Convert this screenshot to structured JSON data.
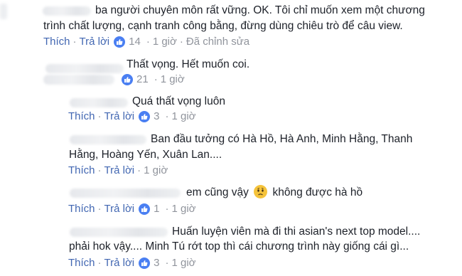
{
  "actions": {
    "like": "Thích",
    "reply": "Trả lời",
    "separator": "·"
  },
  "comments": [
    {
      "lines": [
        "ba người chuyên môn rất vững. OK. Tôi chỉ muốn xem một chương",
        "trình chất lượng, cạnh tranh công bằng, đừng dùng chiêu trò để câu view."
      ],
      "likes": "14",
      "time": "1 giờ",
      "edited": "Đã chỉnh sửa"
    },
    {
      "lines": [
        "Thất vọng. Hết muốn coi."
      ],
      "likes": "21",
      "time": "1 giờ"
    },
    {
      "lines": [
        "Quá thất vọng luôn"
      ],
      "likes": "3",
      "time": "1 giờ"
    },
    {
      "lines": [
        "Ban đầu tưởng có Hà Hồ, Hà Anh, Minh Hằng, Thanh",
        "Hằng, Hoàng Yến, Xuân Lan...."
      ],
      "time": "1 giờ"
    },
    {
      "text_before": "em cũng vậy",
      "emoji": "confused-face",
      "text_after": "không được hà hồ",
      "likes": "1",
      "time": "1 giờ"
    },
    {
      "lines": [
        "Huấn luyện viên mà đi thi asian's next top model....",
        "phải hok vậy.... Minh Tú rớt top thì cái chương trình này giống cái gì..."
      ],
      "likes": "3",
      "time": "1 giờ"
    }
  ],
  "colors": {
    "link": "#4267b2",
    "meta": "#90949c",
    "text": "#1d2129",
    "like_badge": "#4a7ff2"
  }
}
